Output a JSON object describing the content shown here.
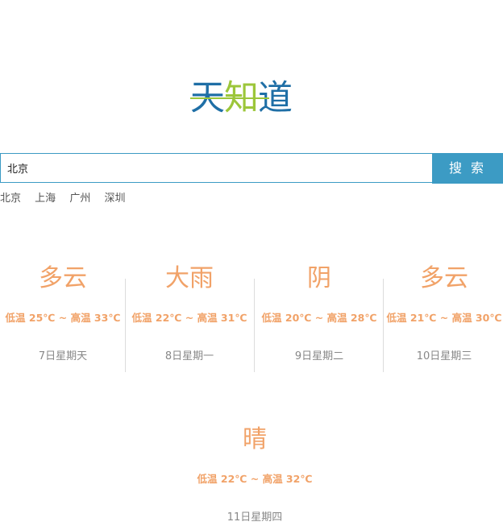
{
  "logo": {
    "char1": "天",
    "char2": "知",
    "char3": "道"
  },
  "search": {
    "value": "北京",
    "button_label": "搜 索"
  },
  "quick_links": [
    "北京",
    "上海",
    "广州",
    "深圳"
  ],
  "forecast": [
    {
      "weather": "多云",
      "temp": "低温 25℃ ~ 高温 33℃",
      "date": "7日星期天"
    },
    {
      "weather": "大雨",
      "temp": "低温 22℃ ~ 高温 31℃",
      "date": "8日星期一"
    },
    {
      "weather": "阴",
      "temp": "低温 20℃ ~ 高温 28℃",
      "date": "9日星期二"
    },
    {
      "weather": "多云",
      "temp": "低温 21℃ ~ 高温 30℃",
      "date": "10日星期三"
    },
    {
      "weather": "晴",
      "temp": "低温 22℃ ~ 高温 32℃",
      "date": "11日星期四"
    }
  ],
  "colors": {
    "brand_blue": "#1f6fa6",
    "brand_green": "#9cc63a",
    "accent": "#3c9bc4",
    "weather_orange": "#f1a268"
  }
}
